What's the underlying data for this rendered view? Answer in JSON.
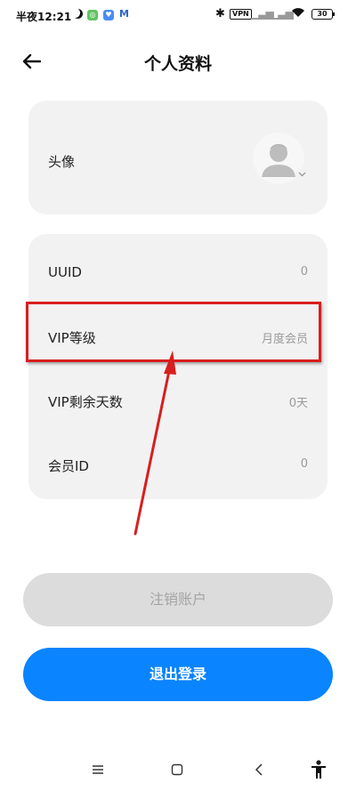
{
  "status_bar": {
    "time": "半夜12:21",
    "vpn": "VPN",
    "battery": "30"
  },
  "header": {
    "title": "个人资料",
    "back_icon": "arrow-left-icon"
  },
  "avatar_section": {
    "label": "头像",
    "icon": "default-avatar-icon"
  },
  "info_rows": [
    {
      "label": "UUID",
      "value": "0"
    },
    {
      "label": "VIP等级",
      "value": "月度会员"
    },
    {
      "label": "VIP剩余天数",
      "value": "0天"
    },
    {
      "label": "会员ID",
      "value": "0"
    }
  ],
  "buttons": {
    "cancel_account": "注销账户",
    "logout": "退出登录"
  },
  "colors": {
    "accent": "#0a84ff",
    "card_bg": "#f2f2f2",
    "disabled_button": "#dcdcdc",
    "annotation": "#d81e1e"
  },
  "nav_bar": {
    "icons": [
      "menu-icon",
      "home-square-icon",
      "back-chevron-icon",
      "accessibility-icon"
    ]
  }
}
